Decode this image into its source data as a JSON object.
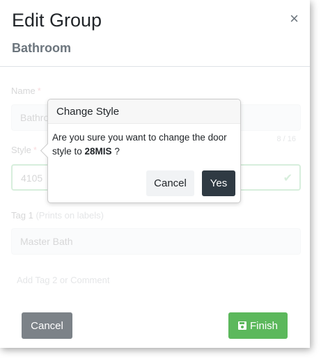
{
  "modal": {
    "title": "Edit Group",
    "subtitle": "Bathroom",
    "close_icon": "×"
  },
  "form": {
    "name_label": "Name",
    "name_required": "*",
    "name_value": "Bathroom",
    "name_counter": "8 / 16",
    "style_label": "Style",
    "style_required": "*",
    "style_value": "4105",
    "style_check_icon": "✔",
    "tag1_label": "Tag 1",
    "tag1_hint": "(Prints on labels)",
    "tag1_value": "Master Bath",
    "add_tag_link": "Add Tag 2 or Comment"
  },
  "footer": {
    "cancel_label": "Cancel",
    "finish_label": "Finish",
    "finish_icon": "save-icon"
  },
  "popover": {
    "title": "Change Style",
    "message_prefix": "Are you sure you want to change the door style to ",
    "style_name": "28MIS",
    "message_suffix": " ?",
    "cancel_label": "Cancel",
    "yes_label": "Yes"
  },
  "colors": {
    "finish_green": "#5cb85c",
    "cancel_gray": "#7c8288",
    "yes_dark": "#2f3a43",
    "valid_green": "#28a745",
    "required_red": "#dc3545"
  }
}
